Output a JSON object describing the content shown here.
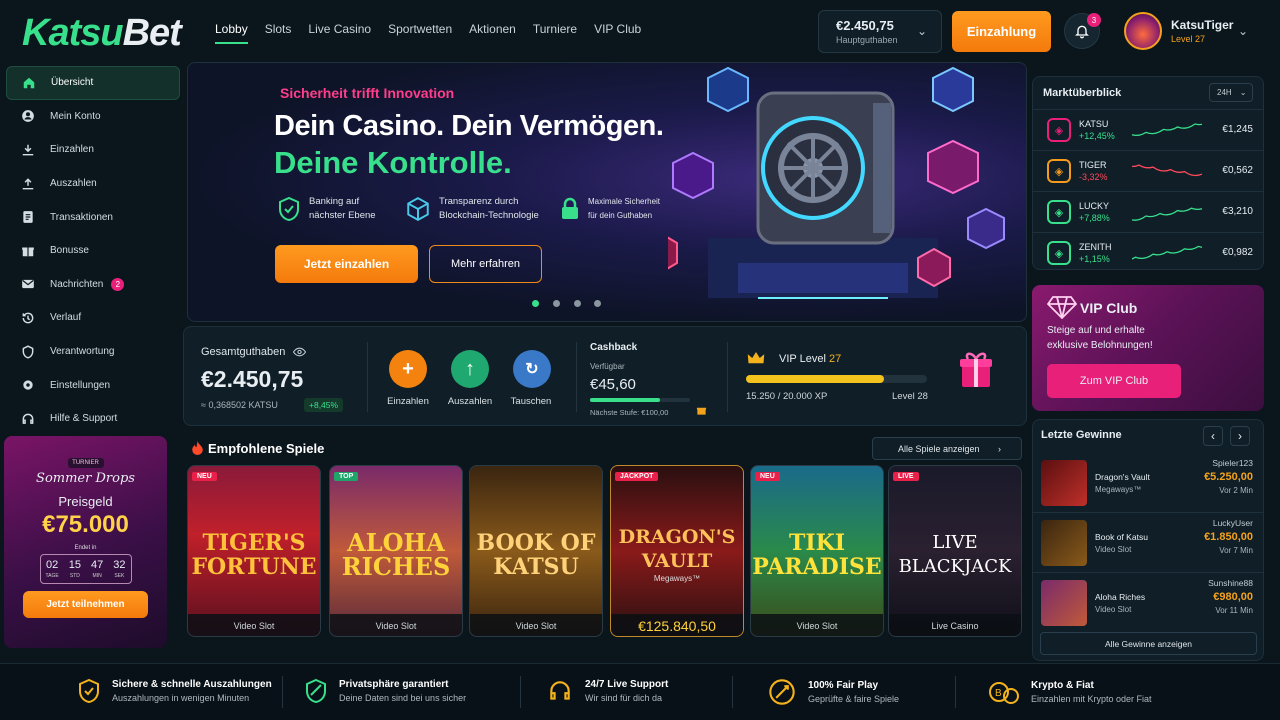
{
  "brand": {
    "logo_part1": "Katsu",
    "logo_part2": "Bet"
  },
  "nav": [
    "Lobby",
    "Slots",
    "Live Casino",
    "Sportwetten",
    "Aktionen",
    "Turniere",
    "VIP Club"
  ],
  "balance": {
    "value": "€2.450,75",
    "label": "Hauptguthaben"
  },
  "deposit_button": "Einzahlung",
  "notifications": {
    "count": "3"
  },
  "user": {
    "name": "KatsuTiger",
    "level": "Level 27"
  },
  "sidebar": [
    {
      "label": "Übersicht",
      "icon": "home-icon"
    },
    {
      "label": "Mein Konto",
      "icon": "user-icon"
    },
    {
      "label": "Einzahlen",
      "icon": "download-icon"
    },
    {
      "label": "Auszahlen",
      "icon": "upload-icon"
    },
    {
      "label": "Transaktionen",
      "icon": "document-icon"
    },
    {
      "label": "Bonusse",
      "icon": "gift-icon"
    },
    {
      "label": "Nachrichten",
      "icon": "mail-icon",
      "badge": "2"
    },
    {
      "label": "Verlauf",
      "icon": "history-icon"
    },
    {
      "label": "Verantwortung",
      "icon": "shield-icon"
    },
    {
      "label": "Einstellungen",
      "icon": "gear-icon"
    },
    {
      "label": "Hilfe & Support",
      "icon": "headset-icon"
    }
  ],
  "tournament": {
    "tag": "TURNIER",
    "title": "Sommer Drops",
    "prize_label": "Preisgeld",
    "prize": "€75.000",
    "ends_label": "Endet in",
    "countdown": [
      {
        "n": "02",
        "u": "TAGE"
      },
      {
        "n": "15",
        "u": "STD"
      },
      {
        "n": "47",
        "u": "MIN"
      },
      {
        "n": "32",
        "u": "SEK"
      }
    ],
    "button": "Jetzt teilnehmen"
  },
  "hero": {
    "kicker": "Sicherheit trifft Innovation",
    "title1": "Dein Casino. Dein Vermögen.",
    "title2": "Deine Kontrolle.",
    "features": [
      {
        "line1": "Banking auf",
        "line2": "nächster Ebene"
      },
      {
        "line1": "Transparenz durch",
        "line2": "Blockchain-Technologie"
      },
      {
        "line1": "Maximale Sicherheit",
        "line2": "für dein Guthaben"
      }
    ],
    "primary_button": "Jetzt einzahlen",
    "secondary_button": "Mehr erfahren",
    "slide_active": 1,
    "slide_count": 4
  },
  "wallet": {
    "label": "Gesamtguthaben",
    "value": "€2.450,75",
    "crypto": "≈ 0,368502 KATSU",
    "change": "+8,45%",
    "actions": [
      "Einzahlen",
      "Auszahlen",
      "Tauschen"
    ]
  },
  "cashback": {
    "title": "Cashback",
    "avail_label": "Verfügbar",
    "value": "€45,60",
    "progress": 0.7,
    "next": "Nächste Stufe: €100,00"
  },
  "vip_progress": {
    "label": "VIP Level",
    "level": "27",
    "xp": "15.250 / 20.000 XP",
    "next_level": "Level 28",
    "progress": 0.7625
  },
  "games_section": {
    "title": "Empfohlene Spiele",
    "all_button": "Alle Spiele anzeigen",
    "games": [
      {
        "title": "TIGER'S FORTUNE",
        "sub": "Video Slot",
        "badge": "NEU",
        "badge_color": "#e8204a"
      },
      {
        "title": "ALOHA RICHES",
        "sub": "Video Slot",
        "badge": "TOP",
        "badge_color": "#1fa56a"
      },
      {
        "title": "BOOK OF KATSU",
        "sub": "Video Slot",
        "badge": "",
        "badge_color": ""
      },
      {
        "title": "DRAGON'S VAULT",
        "tagline": "Megaways™",
        "sub": "€125.840,50",
        "badge": "JACKPOT",
        "badge_color": "#e8204a"
      },
      {
        "title": "TIKI PARADISE",
        "sub": "Video Slot",
        "badge": "NEU",
        "badge_color": "#e8204a"
      },
      {
        "title": "LIVE BLACKJACK",
        "sub": "Live Casino",
        "badge": "LIVE",
        "badge_color": "#e8204a"
      }
    ]
  },
  "market": {
    "title": "Marktüberblick",
    "period": "24H",
    "rows": [
      {
        "sym": "KATSU",
        "chg": "+12,45%",
        "price": "€1,245",
        "up": true,
        "color": "#e8207a"
      },
      {
        "sym": "TIGER",
        "chg": "-3,32%",
        "price": "€0,562",
        "up": false,
        "color": "#f49a1c"
      },
      {
        "sym": "LUCKY",
        "chg": "+7,88%",
        "price": "€3,210",
        "up": true,
        "color": "#38e08c"
      },
      {
        "sym": "ZENITH",
        "chg": "+1,15%",
        "price": "€0,982",
        "up": true,
        "color": "#38e08c"
      }
    ]
  },
  "vip_club": {
    "title": "VIP Club",
    "text1": "Steige auf und erhalte",
    "text2": "exklusive Belohnungen!",
    "button": "Zum VIP Club"
  },
  "winners": {
    "title": "Letzte Gewinne",
    "rows": [
      {
        "game": "Dragon's Vault",
        "type": "Megaways™",
        "user": "Spieler123",
        "amount": "€5.250,00",
        "time": "Vor 2 Min"
      },
      {
        "game": "Book of Katsu",
        "type": "Video Slot",
        "user": "LuckyUser",
        "amount": "€1.850,00",
        "time": "Vor 7 Min"
      },
      {
        "game": "Aloha Riches",
        "type": "Video Slot",
        "user": "Sunshine88",
        "amount": "€980,00",
        "time": "Vor 11 Min"
      }
    ],
    "all_button": "Alle Gewinne anzeigen"
  },
  "footer": [
    {
      "title": "Sichere & schnelle Auszahlungen",
      "sub": "Auszahlungen in wenigen Minuten",
      "icon": "shield-check-icon"
    },
    {
      "title": "Privatsphäre garantiert",
      "sub": "Deine Daten sind bei uns sicher",
      "icon": "privacy-shield-icon"
    },
    {
      "title": "24/7 Live Support",
      "sub": "Wir sind für dich da",
      "icon": "headset-icon"
    },
    {
      "title": "100% Fair Play",
      "sub": "Geprüfte & faire Spiele",
      "icon": "fairplay-icon"
    },
    {
      "title": "Krypto & Fiat",
      "sub": "Einzahlen mit Krypto oder Fiat",
      "icon": "coins-icon"
    }
  ],
  "colors": {
    "accent_green": "#38e08c",
    "accent_orange": "#f47a0c",
    "accent_pink": "#e8207a",
    "bg": "#0a151c"
  }
}
